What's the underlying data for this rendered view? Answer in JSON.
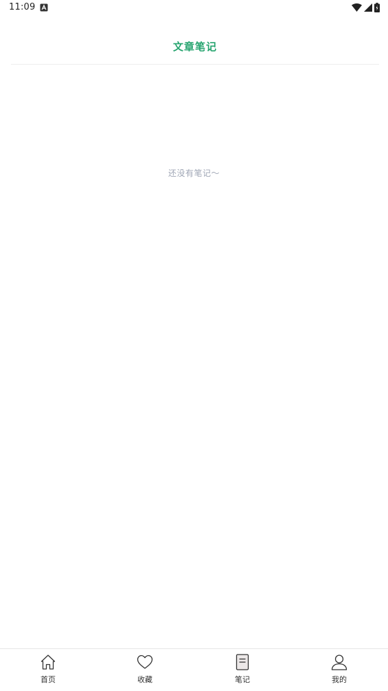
{
  "status_bar": {
    "time": "11:09"
  },
  "header": {
    "title": "文章笔记"
  },
  "content": {
    "empty_message": "还没有笔记～"
  },
  "tab_bar": {
    "items": [
      {
        "label": "首页",
        "icon": "home-icon"
      },
      {
        "label": "收藏",
        "icon": "heart-icon"
      },
      {
        "label": "笔记",
        "icon": "note-icon",
        "active": true
      },
      {
        "label": "我的",
        "icon": "user-icon"
      }
    ]
  },
  "colors": {
    "accent": "#26a46f",
    "empty_text": "#9fa6b5",
    "tab_text": "#333333",
    "divider": "#eeeeee"
  }
}
